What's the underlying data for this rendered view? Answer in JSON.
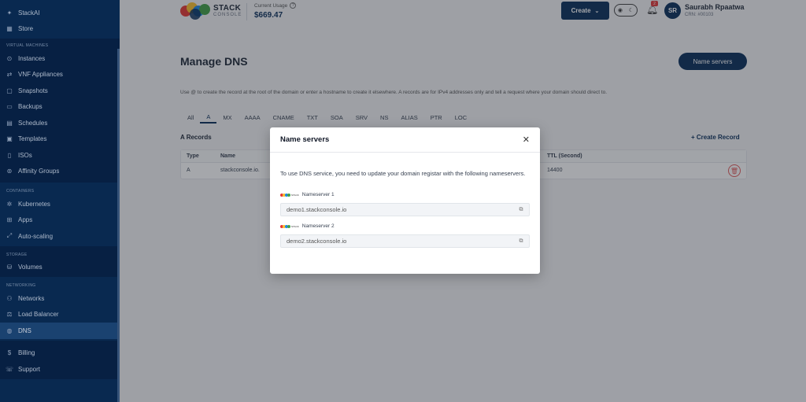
{
  "sidebar": {
    "top_items": [
      {
        "label": "StackAI",
        "icon": "sparkle-icon"
      },
      {
        "label": "Store",
        "icon": "store-icon"
      }
    ],
    "sections": [
      {
        "label": "VIRTUAL MACHINES",
        "items": [
          {
            "label": "Instances"
          },
          {
            "label": "VNF Appliances"
          },
          {
            "label": "Snapshots"
          },
          {
            "label": "Backups"
          },
          {
            "label": "Schedules"
          },
          {
            "label": "Templates"
          },
          {
            "label": "ISOs"
          },
          {
            "label": "Affinity Groups"
          }
        ]
      },
      {
        "label": "CONTAINERS",
        "items": [
          {
            "label": "Kubernetes"
          },
          {
            "label": "Apps"
          },
          {
            "label": "Auto-scaling"
          }
        ]
      },
      {
        "label": "STORAGE",
        "items": [
          {
            "label": "Volumes"
          }
        ]
      },
      {
        "label": "NETWORKING",
        "items": [
          {
            "label": "Networks"
          },
          {
            "label": "Load Balancer"
          },
          {
            "label": "DNS"
          }
        ]
      }
    ],
    "bottom_items": [
      {
        "label": "Billing"
      },
      {
        "label": "Support"
      }
    ]
  },
  "header": {
    "logo_main": "STACK",
    "logo_sub": "CONSOLE",
    "usage_label": "Current Usage",
    "usage_value": "$669.47",
    "create_label": "Create",
    "notifications_count": "2",
    "avatar_initials": "SR",
    "user_name": "Saurabh Rpaatwa",
    "user_id": "CRN: #00103"
  },
  "main": {
    "title": "Manage DNS",
    "name_servers_button": "Name servers",
    "info_text": "Use @ to create the record at the root of the domain or enter a hostname to create it elsewhere. A records are for IPv4 addresses only and tell a request where your domain should direct to.",
    "tabs": [
      "All",
      "A",
      "MX",
      "AAAA",
      "CNAME",
      "TXT",
      "SOA",
      "SRV",
      "NS",
      "ALIAS",
      "PTR",
      "LOC"
    ],
    "active_tab": "A",
    "records_title": "A Records",
    "create_record": "+ Create Record",
    "table": {
      "columns": [
        "Type",
        "Name",
        "TTL (Second)"
      ],
      "rows": [
        {
          "type": "A",
          "name": "stackconsole.io.",
          "ttl": "14400"
        }
      ]
    }
  },
  "modal": {
    "title": "Name servers",
    "description": "To use DNS service, you need to update your domain registar with the following nameservers.",
    "nameservers": [
      {
        "label": "Nameserver 1",
        "value": "demo1.stackconsole.io"
      },
      {
        "label": "Nameserver 2",
        "value": "demo2.stackconsole.io"
      }
    ]
  },
  "colors": {
    "sidebar_bg": "#0a2d57",
    "primary": "#0b2f5a",
    "danger": "#e35d5d"
  }
}
